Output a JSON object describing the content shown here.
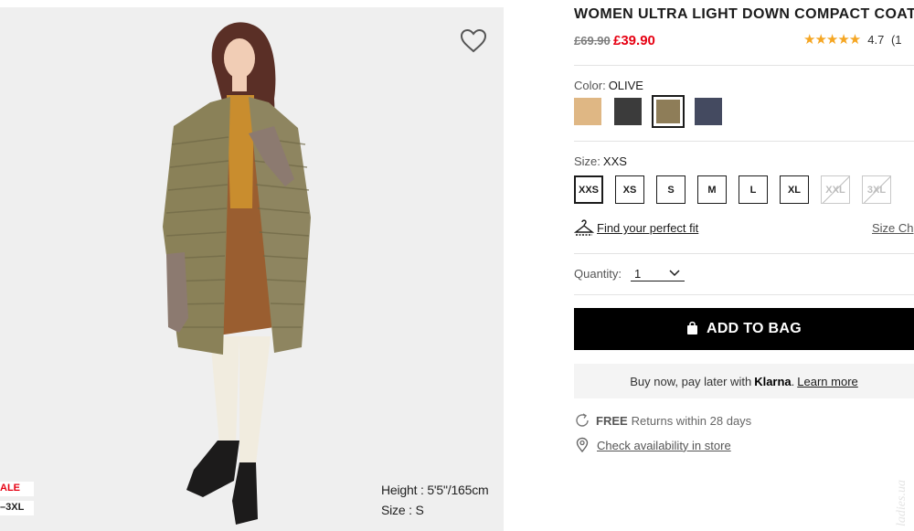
{
  "image": {
    "favorite_icon": "heart-outline-icon",
    "caption_height": "Height : 5'5\"/165cm",
    "caption_size": "Size : S",
    "badge_sale": "ALE",
    "badge_size_range": "–3XL"
  },
  "product": {
    "title": "WOMEN ULTRA LIGHT DOWN COMPACT COAT",
    "price_original": "£69.90",
    "price_sale": "£39.90",
    "stars": "★★★★★",
    "rating_value": "4.7",
    "rating_count": "(1"
  },
  "color": {
    "label": "Color:",
    "selected": "OLIVE",
    "swatches": [
      {
        "name": "beige",
        "hex": "#dfb784"
      },
      {
        "name": "dark-gray",
        "hex": "#3b3b3b"
      },
      {
        "name": "olive",
        "hex": "#8e7d58"
      },
      {
        "name": "navy",
        "hex": "#444a60"
      }
    ]
  },
  "size": {
    "label": "Size:",
    "selected": "XXS",
    "options": [
      "XXS",
      "XS",
      "S",
      "M",
      "L",
      "XL",
      "XXL",
      "3XL"
    ],
    "fit_icon": "hanger-icon",
    "fit_link": "Find your perfect fit",
    "chart_link": "Size Ch"
  },
  "quantity": {
    "label": "Quantity:",
    "value": "1",
    "icon": "chevron-down-icon"
  },
  "add_to_bag": {
    "icon": "shopping-bag-icon",
    "label": "ADD TO BAG"
  },
  "klarna": {
    "text": "Buy now, pay later with",
    "brand": "Klarna",
    "period": ".",
    "learn_more": "Learn more"
  },
  "returns": {
    "icon": "returns-icon",
    "free": "FREE",
    "text": "Returns within 28 days"
  },
  "store": {
    "icon": "location-pin-icon",
    "link": "Check availability in store"
  },
  "colors": {
    "sale_red": "#e60012",
    "black": "#000000",
    "star_gold": "#f5a623",
    "klarna_bg": "#f4f4f4"
  }
}
